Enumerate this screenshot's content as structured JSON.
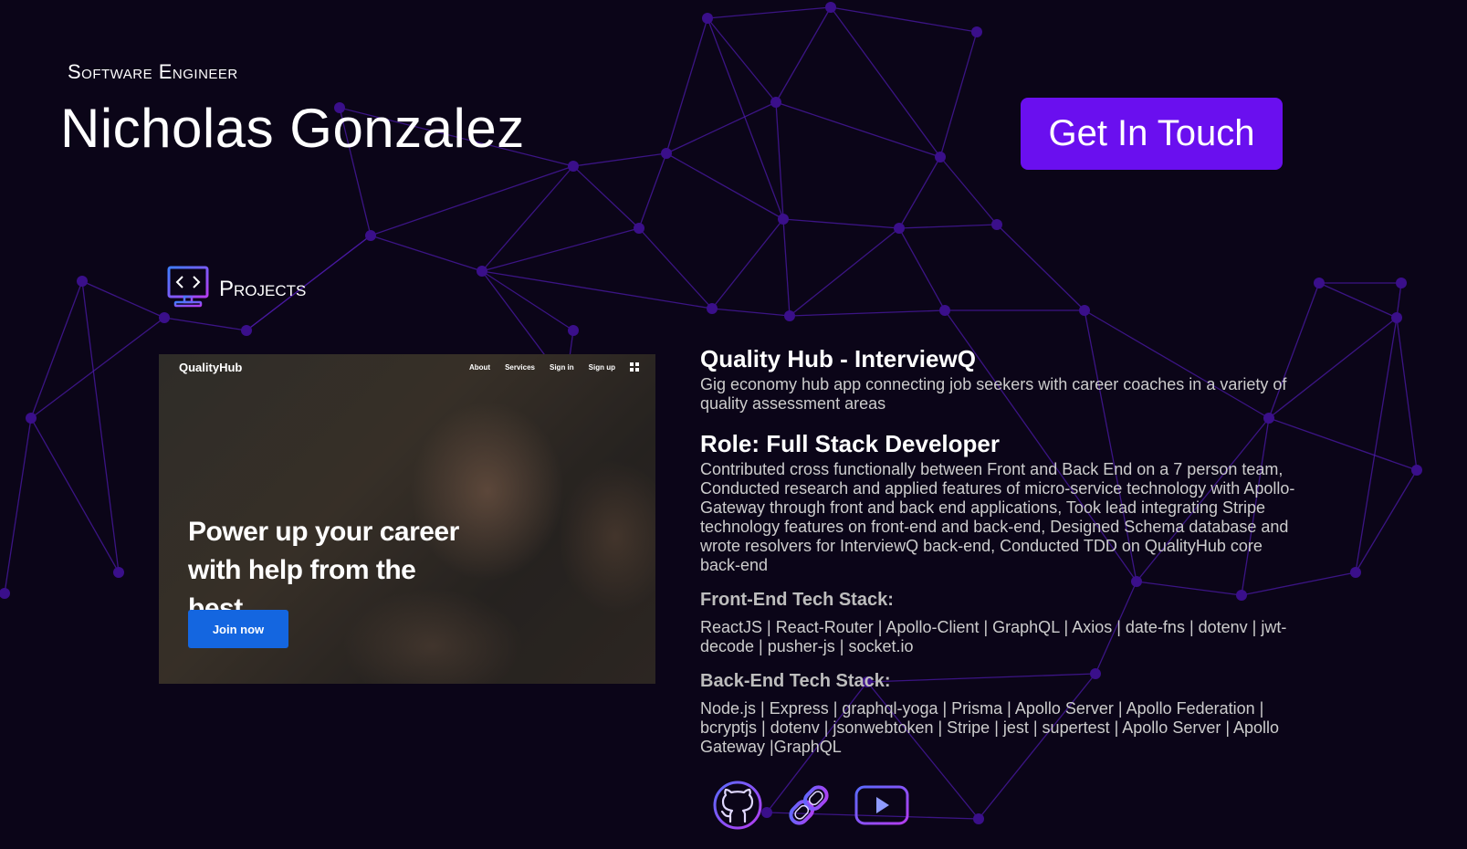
{
  "header": {
    "eyebrow": "Software Engineer",
    "name": "Nicholas Gonzalez",
    "cta_label": "Get In Touch"
  },
  "section": {
    "title": "Projects",
    "icon": "monitor-code-icon"
  },
  "project": {
    "screenshot": {
      "brand": "QualityHub",
      "nav": [
        "About",
        "Services",
        "Sign in",
        "Sign up"
      ],
      "headline": "Power up your career with help from the best.",
      "button": "Join now"
    },
    "title": "Quality Hub - InterviewQ",
    "description": "Gig economy hub app connecting job seekers with career coaches in a variety of quality assessment areas",
    "role": "Role: Full Stack Developer",
    "role_description": "Contributed cross functionally between Front and Back End on a 7 person team, Conducted research and applied features of micro-service technology with Apollo-Gateway through front and back end applications, Took lead integrating Stripe technology features on front-end and back-end, Designed Schema database and wrote resolvers for InterviewQ back-end, Conducted TDD on QualityHub core back-end",
    "frontend_heading": "Front-End Tech Stack:",
    "frontend_stack": "ReactJS | React-Router | Apollo-Client | GraphQL | Axios | date-fns | dotenv | jwt-decode | pusher-js | socket.io",
    "backend_heading": "Back-End Tech Stack:",
    "backend_stack": "Node.js | Express | graphql-yoga | Prisma | Apollo Server | Apollo Federation | bcryptjs | dotenv | jsonwebtoken | Stripe | jest | supertest | Apollo Server | Apollo Gateway |GraphQL",
    "links": [
      "github-icon",
      "chain-link-icon",
      "youtube-play-icon"
    ]
  },
  "colors": {
    "background": "#0b0518",
    "accent": "#6a0fef",
    "network": "#4b1aa8",
    "shot_button": "#1466e0"
  }
}
